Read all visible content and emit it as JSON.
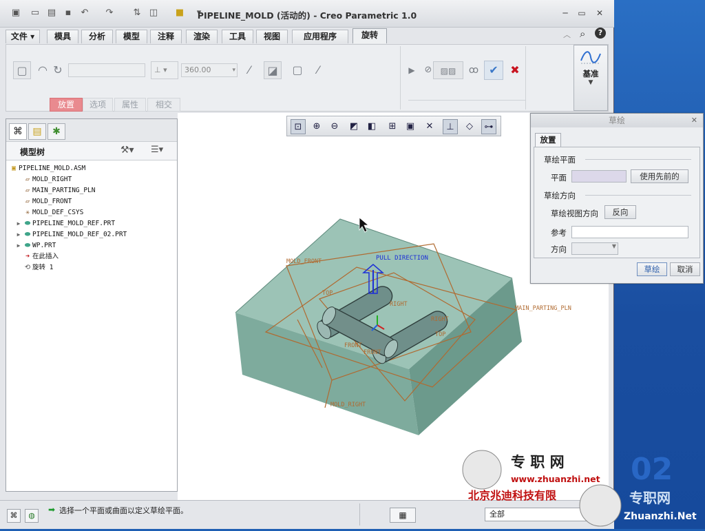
{
  "window": {
    "title": "PIPELINE_MOLD (活动的) - Creo Parametric 1.0"
  },
  "menu": {
    "file": "文件",
    "tabs": [
      "模具",
      "分析",
      "模型",
      "注释",
      "渲染",
      "工具",
      "视图",
      "应用程序",
      "旋转"
    ]
  },
  "ribbon": {
    "angle_value": "360.00",
    "subtabs": [
      "放置",
      "选项",
      "属性",
      "相交"
    ],
    "datum_label": "基准"
  },
  "model_tree": {
    "title": "模型树",
    "items": [
      {
        "label": "PIPELINE_MOLD.ASM",
        "icon": "assembly-icon",
        "indent": 0,
        "expand": false
      },
      {
        "label": "MOLD_RIGHT",
        "icon": "datum-plane-icon",
        "indent": 1,
        "expand": false
      },
      {
        "label": "MAIN_PARTING_PLN",
        "icon": "datum-plane-icon",
        "indent": 1,
        "expand": false
      },
      {
        "label": "MOLD_FRONT",
        "icon": "datum-plane-icon",
        "indent": 1,
        "expand": false
      },
      {
        "label": "MOLD_DEF_CSYS",
        "icon": "csys-icon",
        "indent": 1,
        "expand": false
      },
      {
        "label": "PIPELINE_MOLD_REF.PRT",
        "icon": "part-icon",
        "indent": 1,
        "expand": true
      },
      {
        "label": "PIPELINE_MOLD_REF_02.PRT",
        "icon": "part-icon",
        "indent": 1,
        "expand": true
      },
      {
        "label": "WP.PRT",
        "icon": "part-icon",
        "indent": 1,
        "expand": true
      },
      {
        "label": "在此插入",
        "icon": "insert-here-icon",
        "indent": 1,
        "expand": false
      },
      {
        "label": "旋转 1",
        "icon": "revolve-icon",
        "indent": 1,
        "expand": false
      }
    ]
  },
  "viewport": {
    "labels": {
      "pull_direction": "PULL DIRECTION",
      "mold_front": "MOLD_FRONT",
      "main_parting_pln": "MAIN_PARTING_PLN",
      "mold_right": "MOLD_RIGHT",
      "top1": "TOP",
      "top2": "TOP",
      "right1": "RIGHT",
      "right2": "RIGHT",
      "front1": "FRONT",
      "front2": "FRONT"
    }
  },
  "dialog": {
    "title": "草绘",
    "tab": "放置",
    "section_plane": "草绘平面",
    "plane_label": "平面",
    "use_previous": "使用先前的",
    "section_orient": "草绘方向",
    "view_dir_label": "草绘视图方向",
    "flip": "反向",
    "ref_label": "参考",
    "orient_label": "方向",
    "ok": "草绘",
    "cancel": "取消"
  },
  "status": {
    "message": "选择一个平面或曲面以定义草绘平面。",
    "filter": "全部"
  },
  "watermark": {
    "brand": "专 职 网",
    "url": "www.zhuanzhi.net",
    "company": "北京兆迪科技有限",
    "brand2": "专职网",
    "url2": "Zhuanzhi.Net",
    "corner": "02"
  },
  "colors": {
    "accent_red": "#e98a8f",
    "mold_fill": "#8fb9ac",
    "plane_edge": "#b06a30",
    "desktop": "#1f5fb3"
  }
}
